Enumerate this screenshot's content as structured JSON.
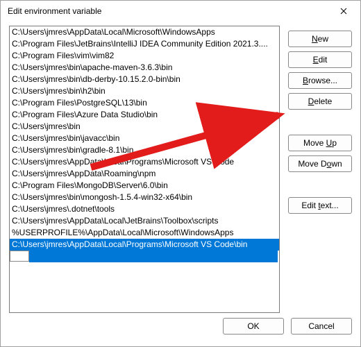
{
  "window": {
    "title": "Edit environment variable"
  },
  "paths": [
    "C:\\Users\\jmres\\AppData\\Local\\Microsoft\\WindowsApps",
    "C:\\Program Files\\JetBrains\\IntelliJ IDEA Community Edition 2021.3....",
    "C:\\Program Files\\vim\\vim82",
    "C:\\Users\\jmres\\bin\\apache-maven-3.6.3\\bin",
    "C:\\Users\\jmres\\bin\\db-derby-10.15.2.0-bin\\bin",
    "C:\\Users\\jmres\\bin\\h2\\bin",
    "C:\\Program Files\\PostgreSQL\\13\\bin",
    "C:\\Program Files\\Azure Data Studio\\bin",
    "C:\\Users\\jmres\\bin",
    "C:\\Users\\jmres\\bin\\javacc\\bin",
    "C:\\Users\\jmres\\bin\\gradle-8.1\\bin",
    "C:\\Users\\jmres\\AppData\\Local\\Programs\\Microsoft VS Code",
    "C:\\Users\\jmres\\AppData\\Roaming\\npm",
    "C:\\Program Files\\MongoDB\\Server\\6.0\\bin",
    "C:\\Users\\jmres\\bin\\mongosh-1.5.4-win32-x64\\bin",
    "C:\\Users\\jmres\\.dotnet\\tools",
    "C:\\Users\\jmres\\AppData\\Local\\JetBrains\\Toolbox\\scripts",
    "%USERPROFILE%\\AppData\\Local\\Microsoft\\WindowsApps",
    "C:\\Users\\jmres\\AppData\\Local\\Programs\\Microsoft VS Code\\bin"
  ],
  "selected_index": 18,
  "buttons": {
    "new": "New",
    "edit": "Edit",
    "browse": "Browse...",
    "delete": "Delete",
    "moveup": "Move Up",
    "movedown": "Move Down",
    "edittext": "Edit text...",
    "ok": "OK",
    "cancel": "Cancel"
  },
  "annotation": {
    "arrow_color": "#e21b1b"
  }
}
